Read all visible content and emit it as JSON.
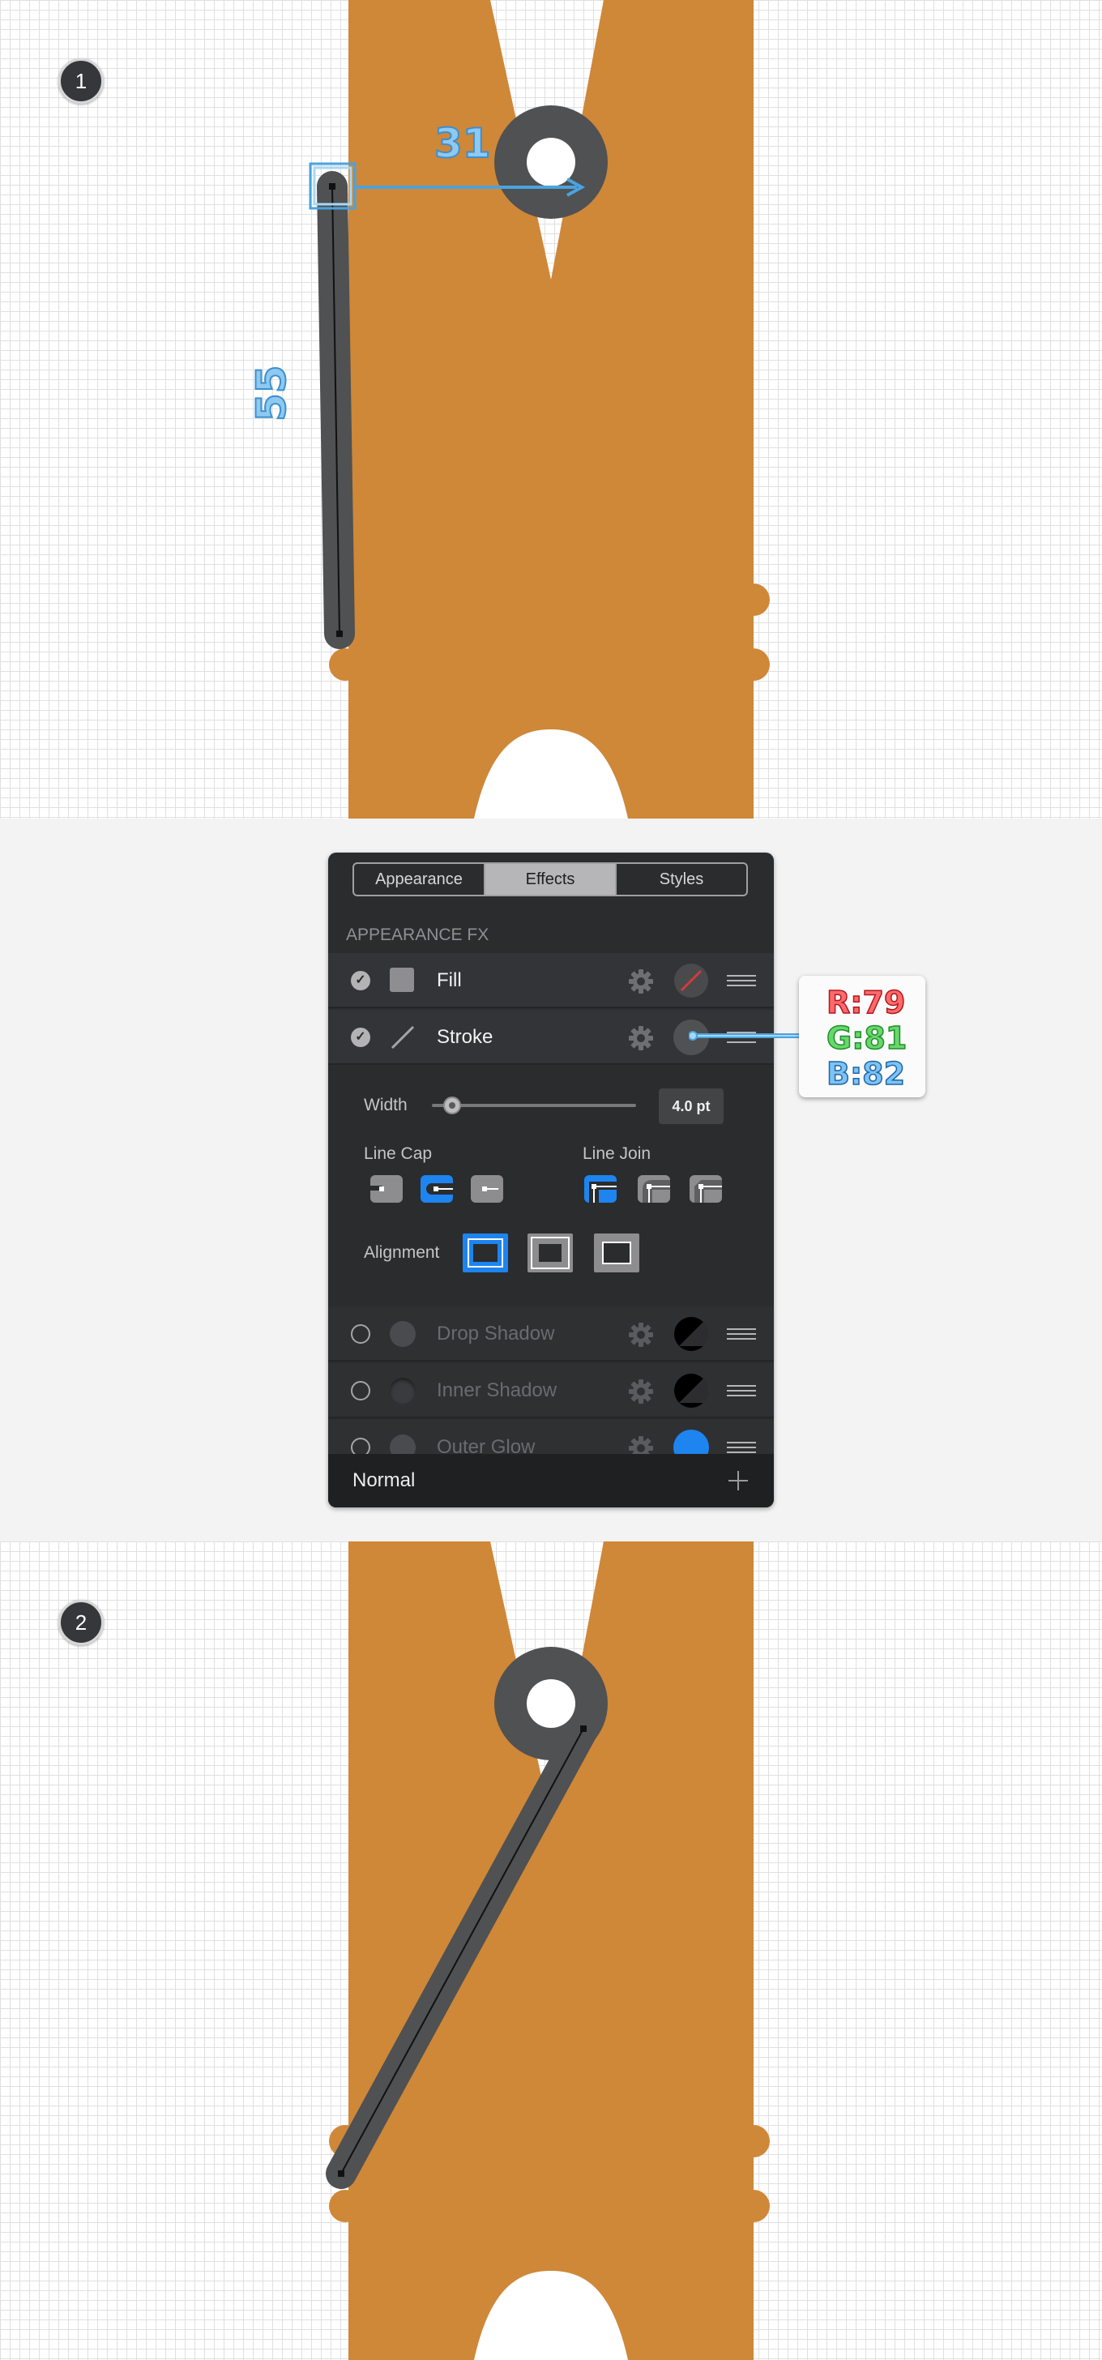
{
  "steps": [
    {
      "number": "1",
      "dimension_horizontal": "31",
      "dimension_vertical": "55"
    },
    {
      "number": "2"
    }
  ],
  "panel": {
    "tabs": [
      {
        "label": "Appearance",
        "active": false
      },
      {
        "label": "Effects",
        "active": true
      },
      {
        "label": "Styles",
        "active": false
      }
    ],
    "section_title": "APPEARANCE FX",
    "effects": [
      {
        "label": "Fill",
        "enabled": true,
        "icon": "fill-square-icon"
      },
      {
        "label": "Stroke",
        "enabled": true,
        "icon": "stroke-line-icon"
      },
      {
        "label": "Drop Shadow",
        "enabled": false
      },
      {
        "label": "Inner Shadow",
        "enabled": false
      },
      {
        "label": "Outer Glow",
        "enabled": false
      }
    ],
    "stroke_settings": {
      "width_label": "Width",
      "width_value": "4.0 pt",
      "width_slider_fraction": 0.08,
      "line_cap_label": "Line Cap",
      "line_cap_selected": "round",
      "line_join_label": "Line Join",
      "line_join_selected": "miter",
      "alignment_label": "Alignment",
      "alignment_selected": "center"
    },
    "blend_mode": "Normal"
  },
  "stroke_color": {
    "r": "R:79",
    "g": "G:81",
    "b": "B:82",
    "hex": "#4f5152"
  },
  "colors": {
    "clothespin": "#cf8738",
    "hole_ring": "#4f5152",
    "accent_blue": "#1d84f0",
    "panel_bg": "#2b2c2e"
  }
}
